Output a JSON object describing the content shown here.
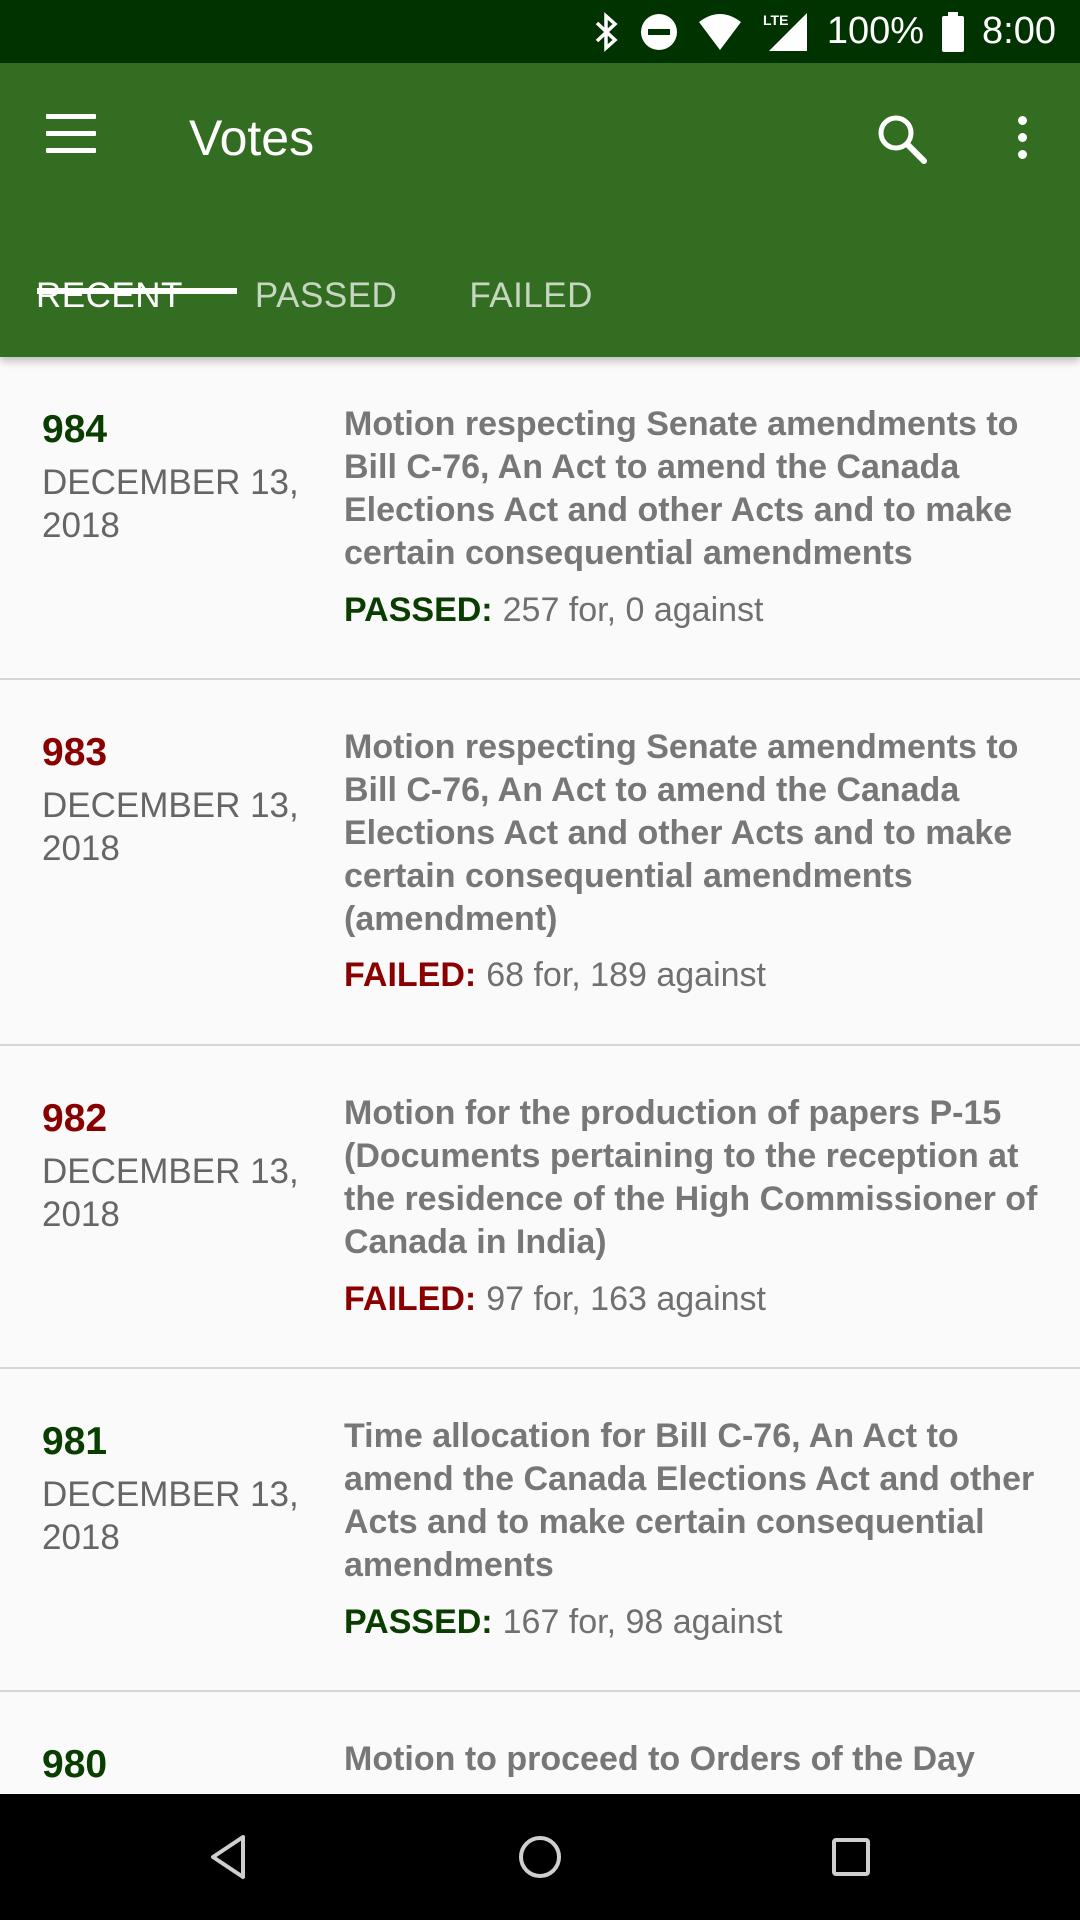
{
  "status_bar": {
    "battery": "100%",
    "time": "8:00",
    "network": "LTE"
  },
  "app_bar": {
    "title": "Votes"
  },
  "tabs": [
    {
      "label": "RECENT",
      "active": true
    },
    {
      "label": "PASSED",
      "active": false
    },
    {
      "label": "FAILED",
      "active": false
    }
  ],
  "colors": {
    "status_bar": "#003300",
    "app_bar": "#336d21",
    "passed": "#0a3d00",
    "failed": "#8a0000"
  },
  "votes": [
    {
      "number": "984",
      "date": "DECEMBER 13, 2018",
      "description": "Motion respecting Senate amendments to Bill C-76, An Act to amend the Canada Elections Act and other Acts and to make certain consequential amendments",
      "status": "PASSED:",
      "tally": "257 for, 0 against",
      "result": "passed"
    },
    {
      "number": "983",
      "date": "DECEMBER 13, 2018",
      "description": "Motion respecting Senate amendments to Bill C-76, An Act to amend the Canada Elections Act and other Acts and to make certain consequential amendments (amendment)",
      "status": "FAILED:",
      "tally": "68 for, 189 against",
      "result": "failed"
    },
    {
      "number": "982",
      "date": "DECEMBER 13, 2018",
      "description": "Motion for the production of papers P-15 (Documents pertaining to the reception at the residence of the High Commissioner of Canada in India)",
      "status": "FAILED:",
      "tally": "97 for, 163 against",
      "result": "failed"
    },
    {
      "number": "981",
      "date": "DECEMBER 13, 2018",
      "description": "Time allocation for Bill C-76, An Act to amend the Canada Elections Act and other Acts and to make certain consequential amendments",
      "status": "PASSED:",
      "tally": "167 for, 98 against",
      "result": "passed"
    },
    {
      "number": "980",
      "description": "Motion to proceed to Orders of the Day",
      "result": "passed"
    }
  ]
}
